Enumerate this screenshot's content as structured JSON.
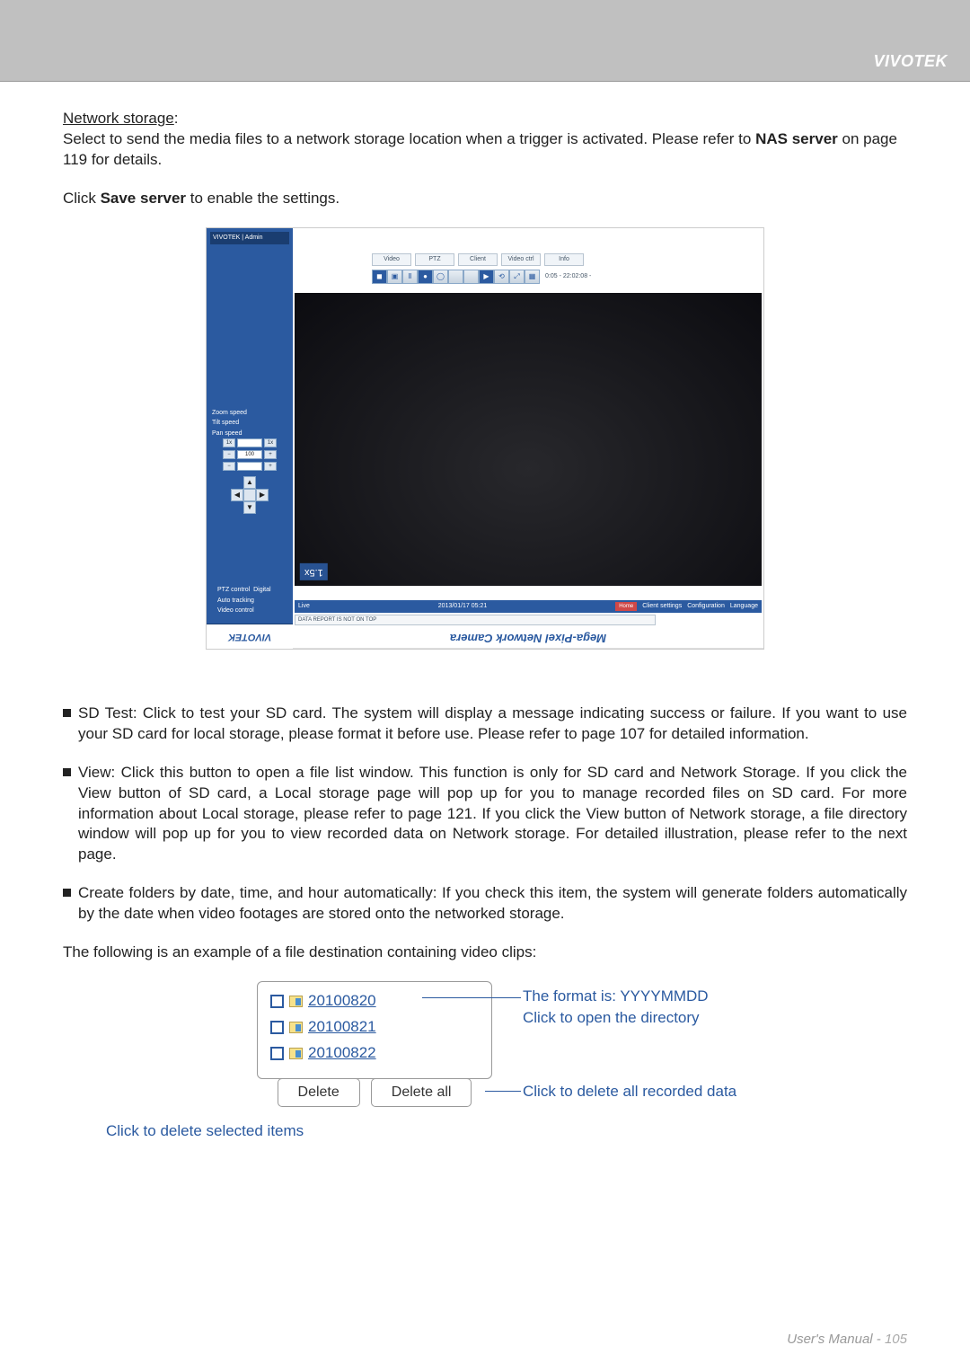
{
  "brand": "VIVOTEK",
  "section_heading": "Network storage",
  "para1_prefix": "Select to send the media files to a network storage location when a trigger is activated. Please refer to ",
  "para1_bold": "NAS server",
  "para1_suffix": " on page 119 for details.",
  "para2_prefix": "Click ",
  "para2_bold": "Save server",
  "para2_suffix": " to enable the settings.",
  "screenshot": {
    "sidebar_top": "VIVOTEK | Admin",
    "labels": {
      "zoom": "Zoom speed",
      "tilt": "Tilt speed",
      "pan": "Pan speed"
    },
    "ctrl_plus": "+",
    "ctrl_minus": "−",
    "ctrl_12": "1x",
    "ctrl_100": "100",
    "ptz_label": "PTZ control",
    "ptz_mode": "Digital",
    "auto_label": "Auto tracking",
    "video_label": "Video control",
    "tabs": {
      "t1": "Video",
      "t2": "PTZ",
      "t3": "Client",
      "t4": "Video ctrl",
      "t5": "Info"
    },
    "tb_text": "0:05 - 22:02:08 -",
    "zoom_badge": "1.5x",
    "status_left": "Live",
    "status_date": "2013/01/17 05:21",
    "status_links": {
      "a": "Client settings",
      "b": "Configuration",
      "c": "Language"
    },
    "status_badge": "Home",
    "info_bar": "DATA REPORT IS NOT ON TOP",
    "title": "Mega-Pixel Network Camera",
    "logo": "VIVOTEK"
  },
  "bullets": {
    "b1": "SD Test: Click to test your SD card. The system will display a message indicating success or failure. If you want to use your SD card for local storage, please format it before use. Please refer to page 107 for detailed information.",
    "b2": "View: Click this button to open a file list window. This function is only for SD card and Network Storage. If you click the View button of SD card, a Local storage page will pop up for you to manage recorded files on SD card. For more information about Local storage, please refer to page 121. If you click the View button of Network storage, a file directory window will pop up for you to view recorded data on Network storage. For detailed illustration, please refer to the next page.",
    "b3": "Create folders by date, time, and hour automatically: If you check this item, the system will generate folders automatically by the date when video footages are stored onto the networked storage."
  },
  "example_intro": "The following is an example of a file destination containing video clips:",
  "folders": {
    "f1": "20100820",
    "f2": "20100821",
    "f3": "20100822"
  },
  "buttons": {
    "delete": "Delete",
    "delete_all": "Delete all"
  },
  "annotations": {
    "format": "The format is: YYYYMMDD",
    "open_dir": "Click to open the directory",
    "delete_all": "Click to delete all recorded data",
    "delete_sel": "Click to delete selected items"
  },
  "footer_text": "User's Manual - ",
  "footer_page": "105"
}
